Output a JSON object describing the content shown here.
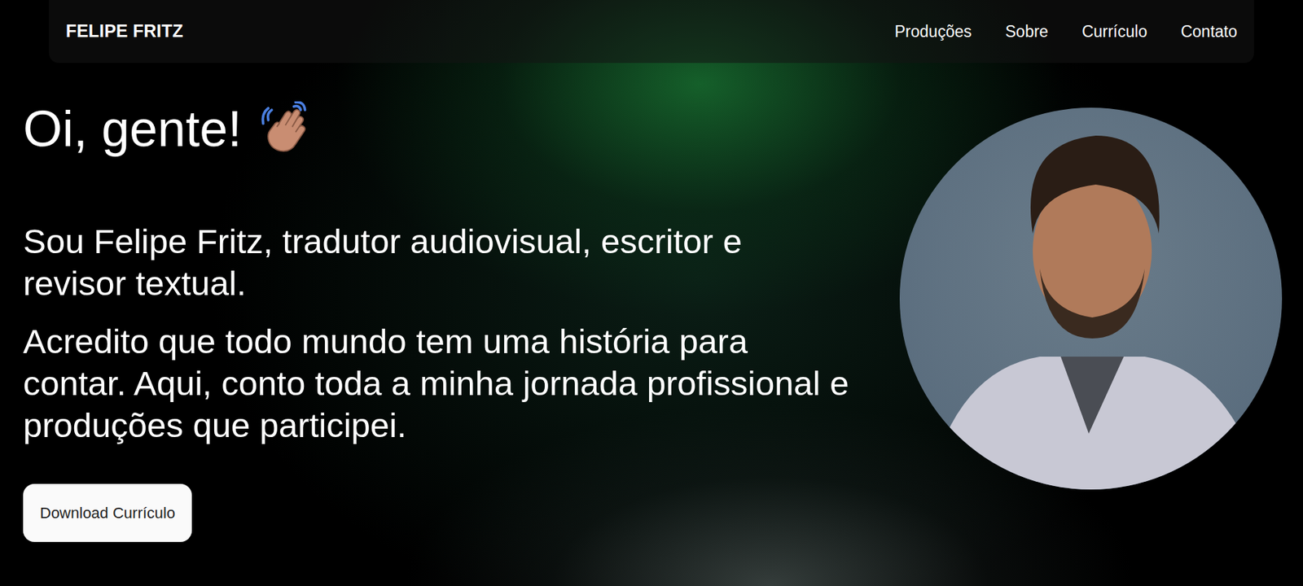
{
  "brand": "FELIPE FRITZ",
  "nav": [
    "Produções",
    "Sobre",
    "Currículo",
    "Contato"
  ],
  "hero": {
    "greeting": "Oi, gente!",
    "paragraphs": [
      "Sou Felipe Fritz, tradutor audiovisual, escritor e revisor textual.",
      "Acredito que todo mundo tem uma história para contar. Aqui, conto toda a minha jornada profissional e produções que participei."
    ],
    "button": "Download Currículo"
  }
}
